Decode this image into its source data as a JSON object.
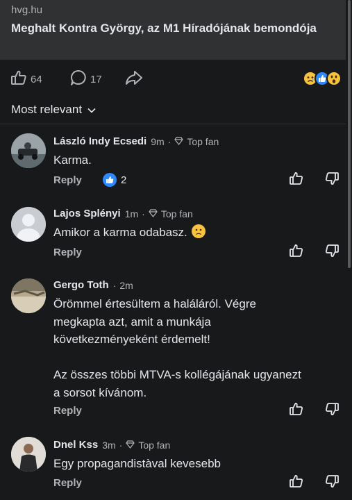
{
  "link": {
    "source": "hvg.hu",
    "title": "Meghalt Kontra György, az M1 Híradójának bemondója"
  },
  "actions": {
    "like_count": "64",
    "comment_count": "17"
  },
  "sort": {
    "label": "Most relevant"
  },
  "icons": {
    "like": "thumbs-up-icon",
    "comment": "comment-bubble-icon",
    "share": "share-arrow-icon",
    "reactions": [
      "sad-reaction-icon",
      "like-reaction-icon",
      "wow-reaction-icon"
    ],
    "top_fan": "diamond-icon",
    "vote_up": "thumb-up-outline-icon",
    "vote_down": "thumb-down-outline-icon"
  },
  "colors": {
    "background": "#18191a",
    "card": "#303133",
    "text": "#e4e6eb",
    "muted": "#b0b3b8",
    "like_blue": "#2e89ff"
  },
  "comments": [
    {
      "name": "László Indy Ecsedi",
      "time": "9m",
      "badge": "Top fan",
      "text": "Karma.",
      "reply": "Reply",
      "reaction_count": "2"
    },
    {
      "name": "Lajos Splényi",
      "time": "1m",
      "badge": "Top fan",
      "text": "Amikor a karma odabasz.",
      "reply": "Reply"
    },
    {
      "name": "Gergo Toth",
      "time": "2m",
      "text_lines": [
        "Örömmel értesültem a haláláról. Végre",
        "megkapta azt, amit a munkája",
        "következményeként érdemelt!",
        "",
        "Az összes többi MTVA-s kollégájának ugyanezt",
        "a sorsot kívánom."
      ],
      "reply": "Reply"
    },
    {
      "name": "Dnel Kss",
      "time": "3m",
      "badge": "Top fan",
      "text": "Egy propagandistàval kevesebb",
      "reply": "Reply"
    }
  ]
}
